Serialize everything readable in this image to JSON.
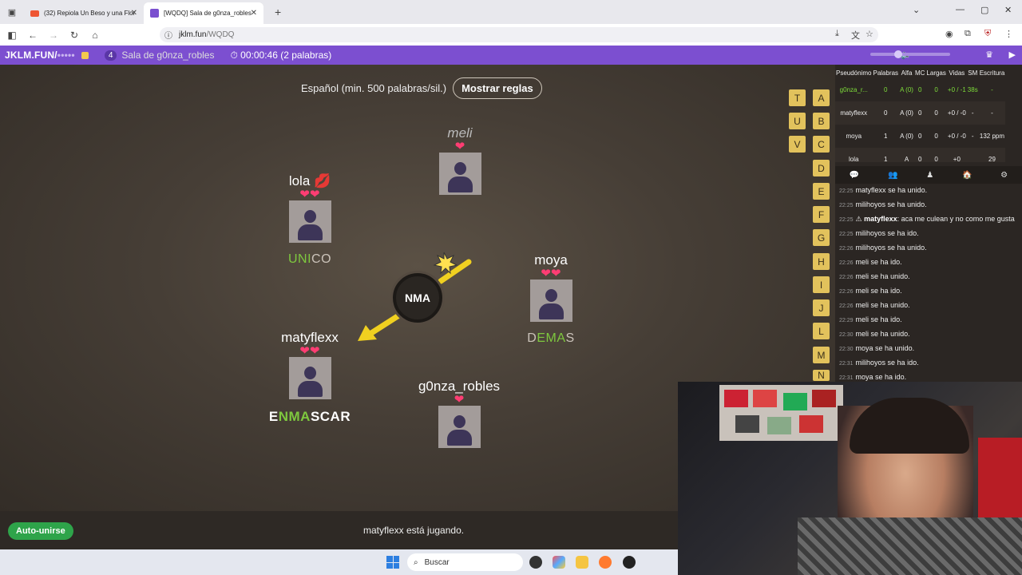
{
  "browser": {
    "tabs": [
      {
        "title": "(32) Repiola Un Beso y una Flor"
      },
      {
        "title": "[WQDQ] Sala de g0nza_robles"
      }
    ],
    "url": {
      "host": "jklm.fun",
      "path": "/WQDQ"
    }
  },
  "gamebar": {
    "brand": "JKLM.FUN/",
    "brand_hidden": "•••••",
    "player_count": "4",
    "room_name": "Sala de g0nza_robles",
    "timer": "00:00:46 (2 palabras)"
  },
  "game": {
    "rules_label": "Español (min. 500 palabras/sil.)",
    "rules_button": "Mostrar reglas",
    "bomb_syllable": "NMA",
    "players": [
      {
        "name": "meli",
        "hearts": "❤",
        "word_pre": "",
        "word_hl": "",
        "word_post": ""
      },
      {
        "name": "lola 💋",
        "hearts": "❤❤",
        "word_pre": "",
        "word_hl": "UNI",
        "word_post": "CO"
      },
      {
        "name": "moya",
        "hearts": "❤❤",
        "word_pre": "D",
        "word_hl": "EMA",
        "word_post": "S"
      },
      {
        "name": "matyflexx",
        "hearts": "❤❤",
        "word_pre": "E",
        "word_hl": "NMA",
        "word_post": "SCAR"
      },
      {
        "name": "g0nza_robles",
        "hearts": "❤",
        "word_pre": "",
        "word_hl": "",
        "word_post": ""
      }
    ],
    "status": "matyflexx está jugando.",
    "auto_join": "Auto-unirse",
    "bonus_letters": [
      "T",
      "A",
      "U",
      "B",
      "V",
      "C",
      "D",
      "E",
      "F",
      "G",
      "H",
      "I",
      "J",
      "L",
      "M",
      "N"
    ]
  },
  "scoreboard": {
    "headers": [
      "Pseudónimo",
      "Palabras",
      "Alfa",
      "MC",
      "Largas",
      "Vidas",
      "SM",
      "Escritura"
    ],
    "rows": [
      [
        "g0nza_r...",
        "0",
        "A (0)",
        "0",
        "0",
        "+0 / -1",
        "38s",
        "-"
      ],
      [
        "matyflexx",
        "0",
        "A (0)",
        "0",
        "0",
        "+0 / -0",
        "-",
        "-"
      ],
      [
        "moya",
        "1",
        "A (0)",
        "0",
        "0",
        "+0 / -0",
        "-",
        "132 ppm"
      ],
      [
        "lola",
        "1",
        "A",
        "0",
        "0",
        "+0",
        "",
        "29"
      ]
    ]
  },
  "chat": [
    {
      "time": "22:25",
      "user": "matyflexx",
      "text": "se ha unido."
    },
    {
      "time": "22:25",
      "user": "milihoyos",
      "text": " se ha unido."
    },
    {
      "time": "22:25",
      "user": "matyflexx",
      "text": ": aca me culean y no como me gusta",
      "bold": true
    },
    {
      "time": "22:25",
      "user": "milihoyos",
      "text": " se ha ido."
    },
    {
      "time": "22:26",
      "user": "milihoyos",
      "text": " se ha unido."
    },
    {
      "time": "22:26",
      "user": "meli",
      "text": " se ha ido."
    },
    {
      "time": "22:26",
      "user": "meli",
      "text": " se ha unido."
    },
    {
      "time": "22:26",
      "user": "meli",
      "text": " se ha ido."
    },
    {
      "time": "22:26",
      "user": "meli",
      "text": " se ha unido."
    },
    {
      "time": "22:29",
      "user": "meli",
      "text": " se ha ido."
    },
    {
      "time": "22:30",
      "user": "meli",
      "text": " se ha unido."
    },
    {
      "time": "22:30",
      "user": "moya",
      "text": " se ha unido."
    },
    {
      "time": "22:31",
      "user": "milihoyos",
      "text": " se ha ido."
    },
    {
      "time": "22:31",
      "user": "moya",
      "text": " se ha ido."
    }
  ],
  "taskbar": {
    "search": "Buscar"
  },
  "colors": {
    "accent": "#7c4fd0",
    "highlight": "#7ec83e",
    "heart": "#ff3d73",
    "letter_tile": "#e2c25c"
  }
}
